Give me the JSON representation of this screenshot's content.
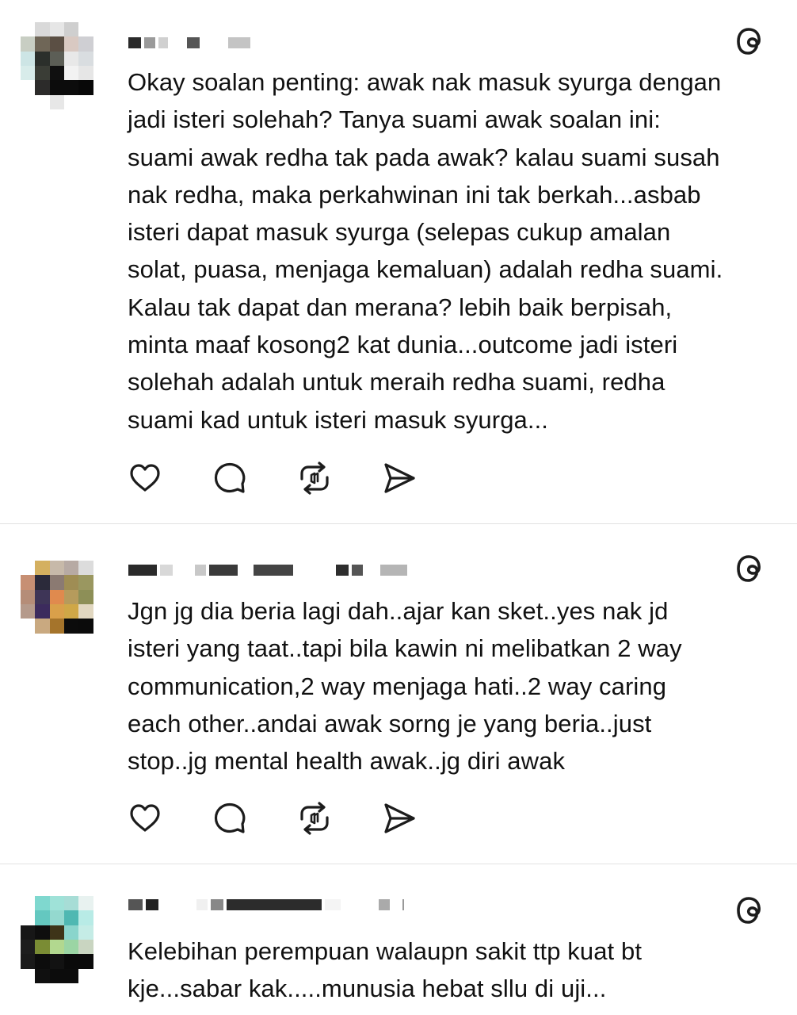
{
  "posts": [
    {
      "text": "Okay soalan penting: awak nak masuk syurga dengan\njadi isteri solehah? Tanya suami awak soalan ini:\nsuami awak redha tak pada awak? kalau suami susah\nnak redha, maka perkahwinan ini tak berkah...asbab\nisteri dapat masuk syurga (selepas cukup amalan\nsolat, puasa, menjaga kemaluan) adalah redha suami.\nKalau tak dapat dan merana? lebih baik berpisah,\nminta maaf kosong2 kat dunia...outcome jadi isteri\nsolehah adalah untuk meraih redha suami, redha\nsuami kad untuk isteri masuk syurga..."
    },
    {
      "text": "Jgn jg dia beria lagi dah..ajar kan sket..yes nak jd\nisteri yang taat..tapi bila kawin ni melibatkan 2 way\ncommunication,2 way menjaga hati..2 way caring\neach other..andai awak sorng je yang beria..just\nstop..jg mental health awak..jg diri awak"
    },
    {
      "text": "Kelebihan perempuan walaupn sakit ttp kuat bt\nkje...sabar kak.....munusia hebat sllu di uji..."
    }
  ],
  "icons": {
    "threads_logo": "threads-logo-icon",
    "like": "heart-icon",
    "reply": "comment-bubble-icon",
    "repost": "repost-icon",
    "share": "send-icon"
  },
  "colors": {
    "text": "#111111",
    "icon": "#1c1c1c",
    "divider": "#e2e2e2",
    "background": "#ffffff"
  }
}
